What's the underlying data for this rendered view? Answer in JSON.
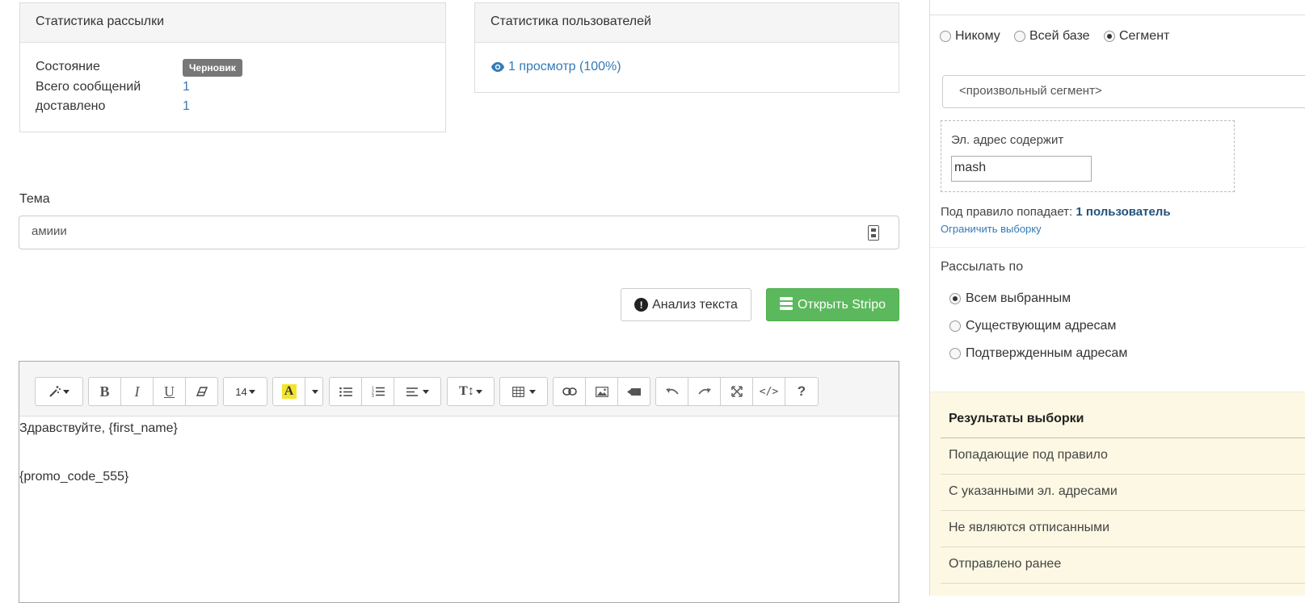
{
  "mail_stats": {
    "title": "Статистика рассылки",
    "state_label": "Состояние",
    "state_badge": "Черновик",
    "total_label": "Всего сообщений",
    "total_value": "1",
    "delivered_label": "доставлено",
    "delivered_value": "1"
  },
  "user_stats": {
    "title": "Статистика пользователей",
    "views": "1 просмотр (100%)"
  },
  "subject": {
    "label": "Тема",
    "value": "амиии"
  },
  "actions": {
    "analysis": "Анализ текста",
    "stripo": "Открыть Stripo"
  },
  "editor": {
    "font_size": "14",
    "lines": [
      "Здравствуйте, {first_name}",
      "",
      "{promo_code_555}"
    ]
  },
  "sidebar": {
    "audience_options": [
      {
        "label": "Никому",
        "checked": false
      },
      {
        "label": "Всей базе",
        "checked": false
      },
      {
        "label": "Сегмент",
        "checked": true
      }
    ],
    "segment_select": "<произвольный сегмент>",
    "rule_label": "Эл. адрес содержит",
    "rule_value": "mash",
    "matches_prefix": "Под правило попадает:",
    "matches_count": "1 пользователь",
    "limit_link": "Ограничить выборку",
    "send_by_label": "Рассылать по",
    "send_by_options": [
      {
        "label": "Всем выбранным",
        "checked": true
      },
      {
        "label": "Существующим адресам",
        "checked": false
      },
      {
        "label": "Подтвержденным адресам",
        "checked": false
      }
    ],
    "results": {
      "title": "Результаты выборки",
      "rows": [
        "Попадающие под правило",
        "С указанными эл. адресами",
        "Не являются отписанными",
        "Отправлено ранее"
      ]
    }
  },
  "colors": {
    "link": "#337ab7",
    "success": "#5cb85c",
    "badge": "#777777",
    "results_bg": "#fcf8e3",
    "highlight_yellow": "#f5e52a"
  }
}
